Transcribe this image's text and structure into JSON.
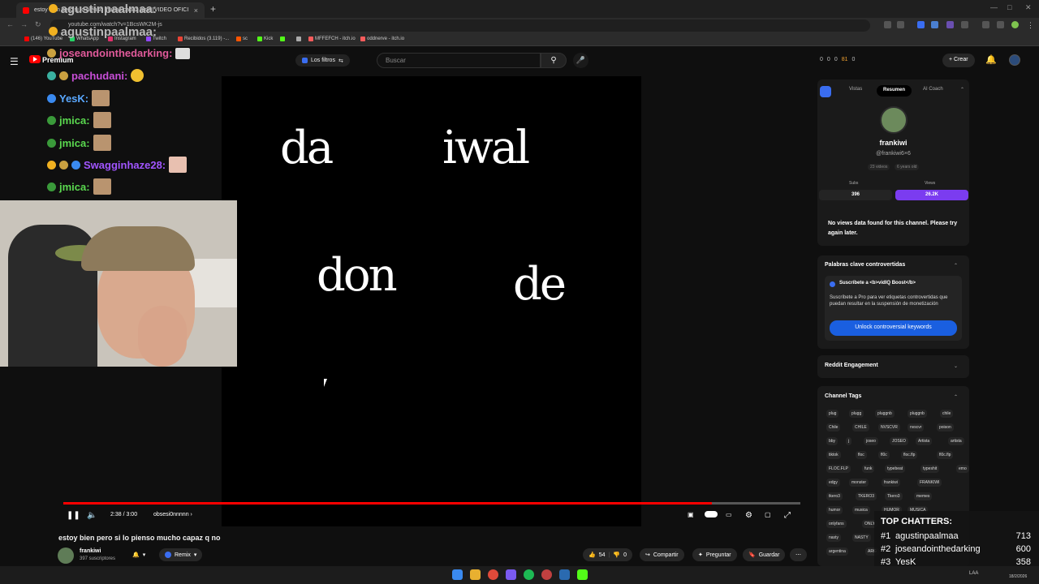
{
  "browser": {
    "tab_title": "estoy bien pero si lo pienso mucho capaz q no [VIDEO OFICIAL]",
    "url": "youtube.com/watch?v=1BcsWK2M-js",
    "bookmarks": [
      "(146) YouTube",
      "WhatsApp",
      "Instagram",
      "Twitch",
      "Recibidos (3.119) -...",
      "sc",
      "Kick",
      "",
      "MFFEFCH - itch.io",
      "oddnerve - itch.io"
    ]
  },
  "header": {
    "premium_label": "Premium",
    "filters_label": "Los filtros",
    "search_placeholder": "Buscar",
    "stats": [
      "0",
      "0",
      "0",
      "81",
      "0"
    ],
    "create_label": "Crear"
  },
  "chat": [
    {
      "user": "agustinpaalmaa:",
      "color": "#b8b8b8"
    },
    {
      "user": "agustinpaalmaa:",
      "color": "#b8b8b8"
    },
    {
      "user": "joseandointhedarking:",
      "color": "#e05a9a"
    },
    {
      "user": "pachudani:",
      "color": "#c94fd8"
    },
    {
      "user": "YesK:",
      "color": "#5aa8ff"
    },
    {
      "user": "jmica:",
      "color": "#5ad84f"
    },
    {
      "user": "jmica:",
      "color": "#5ad84f"
    },
    {
      "user": "Swagginhaze28:",
      "color": "#a155ff"
    },
    {
      "user": "jmica:",
      "color": "#5ad84f"
    }
  ],
  "video": {
    "words": [
      "da",
      "iwal",
      "don",
      "de"
    ],
    "time": "2:38 / 3:00",
    "chapter": "obsesi0nnnnn",
    "progress": 0.88,
    "title": "estoy bien pero si lo pienso mucho capaz q no",
    "channel": "frankiwi",
    "subscribers": "397 suscriptores",
    "remix_label": "Remix",
    "likes": "54",
    "dislikes": "0",
    "share_label": "Compartir",
    "ask_label": "Preguntar",
    "save_label": "Guardar"
  },
  "panel": {
    "tabs": [
      "Vistas",
      "Resumen",
      "AI Coach"
    ],
    "name": "frankiwi",
    "handle": "@frankiwi6×6",
    "videos": "23 videos",
    "age": "6 years old",
    "subs_label": "Subs",
    "subs_value": "396",
    "views_label": "Views",
    "views_value": "26.2K",
    "no_views": "No views data found for this channel. Please try again later.",
    "keywords_title": "Palabras clave controvertidas",
    "boost_heading": "Suscríbete a <b>vidIQ Boost</b>",
    "boost_text": "Suscríbete a Pro para ver etiquetas controvertidas que puedan resultar en la suspensión de monetización",
    "unlock_label": "Unlock controversial keywords",
    "reddit_title": "Reddit Engagement",
    "tags_title": "Channel Tags",
    "tags": [
      [
        "plug",
        "plugg",
        "pluggnb",
        "pluggnb",
        "chile"
      ],
      [
        "Chile",
        "CHILE",
        "NVSCVR",
        "nvscvr",
        "poison"
      ],
      [
        "bby",
        "j",
        "joseo",
        "JOSEO",
        "Artista",
        "artista"
      ],
      [
        "tiktok",
        "floc",
        "fl0c",
        "floc.flp",
        "fl0c.flp"
      ],
      [
        "FLOC.FLP",
        "funk",
        "typebeat",
        "typeshit",
        "emo"
      ],
      [
        "edgy",
        "monster",
        "frankiwi",
        "FRANKIWI"
      ],
      [
        "tkero3",
        "TKERO3",
        "Tkero3",
        "memes"
      ],
      [
        "humor",
        "musica",
        "HUMOR",
        "MUSICA"
      ],
      [
        "onlyfans",
        "ONLY"
      ],
      [
        "nasty",
        "NASTY"
      ],
      [
        "argentina",
        "ARG"
      ]
    ]
  },
  "top_chatters": {
    "title": "TOP CHATTERS:",
    "rows": [
      {
        "rank": "#1",
        "name": "agustinpaalmaa",
        "count": "713"
      },
      {
        "rank": "#2",
        "name": "joseandointhedarking",
        "count": "600"
      },
      {
        "rank": "#3",
        "name": "YesK",
        "count": "358"
      }
    ]
  },
  "taskbar": {
    "lang": "LAA",
    "date": "18/2/2026"
  },
  "colors": {
    "youtube_red": "#ff0000",
    "vidiq_purple": "#7b3cf0",
    "vidiq_blue": "#1a5fe0"
  }
}
